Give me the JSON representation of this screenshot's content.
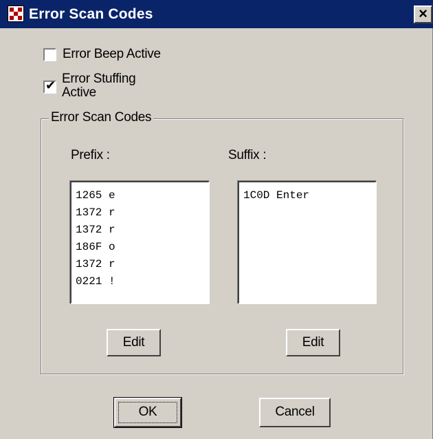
{
  "window": {
    "title": "Error Scan Codes",
    "close_glyph": "×",
    "app_icon": "app-icon"
  },
  "options": {
    "beep": {
      "label": "Error Beep Active",
      "checked": false
    },
    "stuffing": {
      "label_line1": "Error Stuffing",
      "label_line2": "Active",
      "checked": true
    }
  },
  "group": {
    "title": "Error Scan Codes",
    "prefix": {
      "label": "Prefix :",
      "items": [
        "1265 e",
        "1372 r",
        "1372 r",
        "186F o",
        "1372 r",
        "0221 !"
      ],
      "edit_label": "Edit"
    },
    "suffix": {
      "label": "Suffix :",
      "items": [
        "1C0D Enter"
      ],
      "edit_label": "Edit"
    }
  },
  "buttons": {
    "ok_label": "OK",
    "cancel_label": "Cancel"
  },
  "colors": {
    "titlebar": "#0a246a",
    "face": "#d4d0c8",
    "icon_accent": "#b00000"
  }
}
